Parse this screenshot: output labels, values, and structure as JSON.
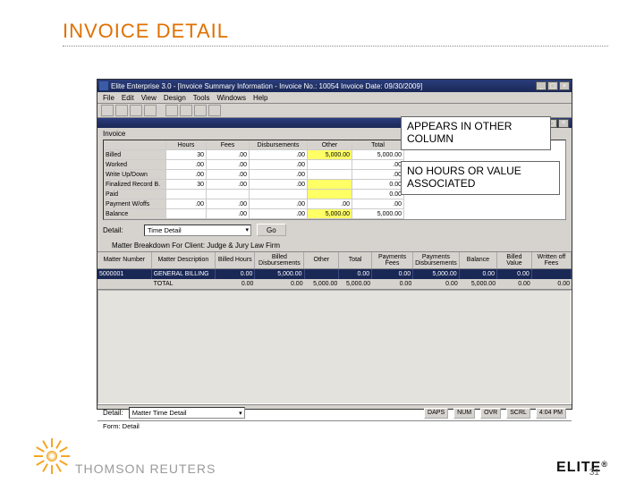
{
  "slide": {
    "title": "INVOICE DETAIL",
    "page_number": "31"
  },
  "callouts": {
    "c1": "APPEARS IN OTHER COLUMN",
    "c2": "NO HOURS OR VALUE ASSOCIATED"
  },
  "window": {
    "title": "Elite Enterprise 3.0 - [Invoice Summary Information - Invoice No.: 10054 Invoice Date: 09/30/2009]",
    "menus": [
      "File",
      "Edit",
      "View",
      "Design",
      "Tools",
      "Windows",
      "Help"
    ],
    "panel_label": "Invoice",
    "summary": {
      "headers": [
        "",
        "Hours",
        "Fees",
        "Disbursements",
        "Other",
        "Total"
      ],
      "rows": [
        {
          "label": "Billed",
          "cells": [
            "30",
            ".00",
            ".00",
            "5,000.00",
            "5,000.00"
          ]
        },
        {
          "label": "Worked",
          "cells": [
            ".00",
            ".00",
            ".00",
            "",
            ".00"
          ]
        },
        {
          "label": "Write Up/Down",
          "cells": [
            ".00",
            ".00",
            ".00",
            "",
            ".00"
          ]
        },
        {
          "label": "Finalized Record B.",
          "cells": [
            "30",
            ".00",
            ".00",
            "",
            "0.00"
          ]
        },
        {
          "label": "Paid",
          "cells": [
            "",
            "",
            "",
            "",
            "0.00"
          ]
        },
        {
          "label": "Payment W/offs",
          "cells": [
            ".00",
            ".00",
            ".00",
            ".00",
            ".00"
          ]
        },
        {
          "label": "Balance",
          "cells": [
            "",
            ".00",
            ".00",
            "5,000.00",
            "5,000.00"
          ]
        }
      ]
    },
    "detail": {
      "label": "Detail:",
      "dropdown_value": "Time Detail",
      "go_label": "Go"
    },
    "client_line": "Matter Breakdown For Client:   Judge & Jury Law Firm",
    "grid_headers": [
      "Matter Number",
      "Matter Description",
      "Billed Hours",
      "Billed Disbursements",
      "Other",
      "Total",
      "Payments Fees",
      "Payments Disbursements",
      "Balance",
      "Billed Value",
      "Written off Fees"
    ],
    "data_row": [
      "5000001",
      "GENERAL BILLING",
      "0.00",
      "",
      "5,000.00",
      "",
      "0.00",
      "",
      "0.00",
      "5,000.00",
      "0.00",
      "0.00"
    ],
    "total_row": {
      "label": "TOTAL",
      "values": [
        "0.00",
        "0.00",
        "5,000.00",
        "5,000.00",
        "0.00",
        "0.00",
        "5,000.00",
        "0.00",
        "0.00"
      ]
    },
    "footer": {
      "detail_label": "Detail:",
      "dropdown_value": "Matter Time Detail",
      "status": [
        "DAPS",
        "NUM",
        "OVR",
        "SCRL",
        "4:04 PM"
      ]
    },
    "form_label": "Form: Detail"
  },
  "brand": {
    "tr": "THOMSON REUTERS",
    "elite": "ELITE",
    "reg": "®"
  }
}
